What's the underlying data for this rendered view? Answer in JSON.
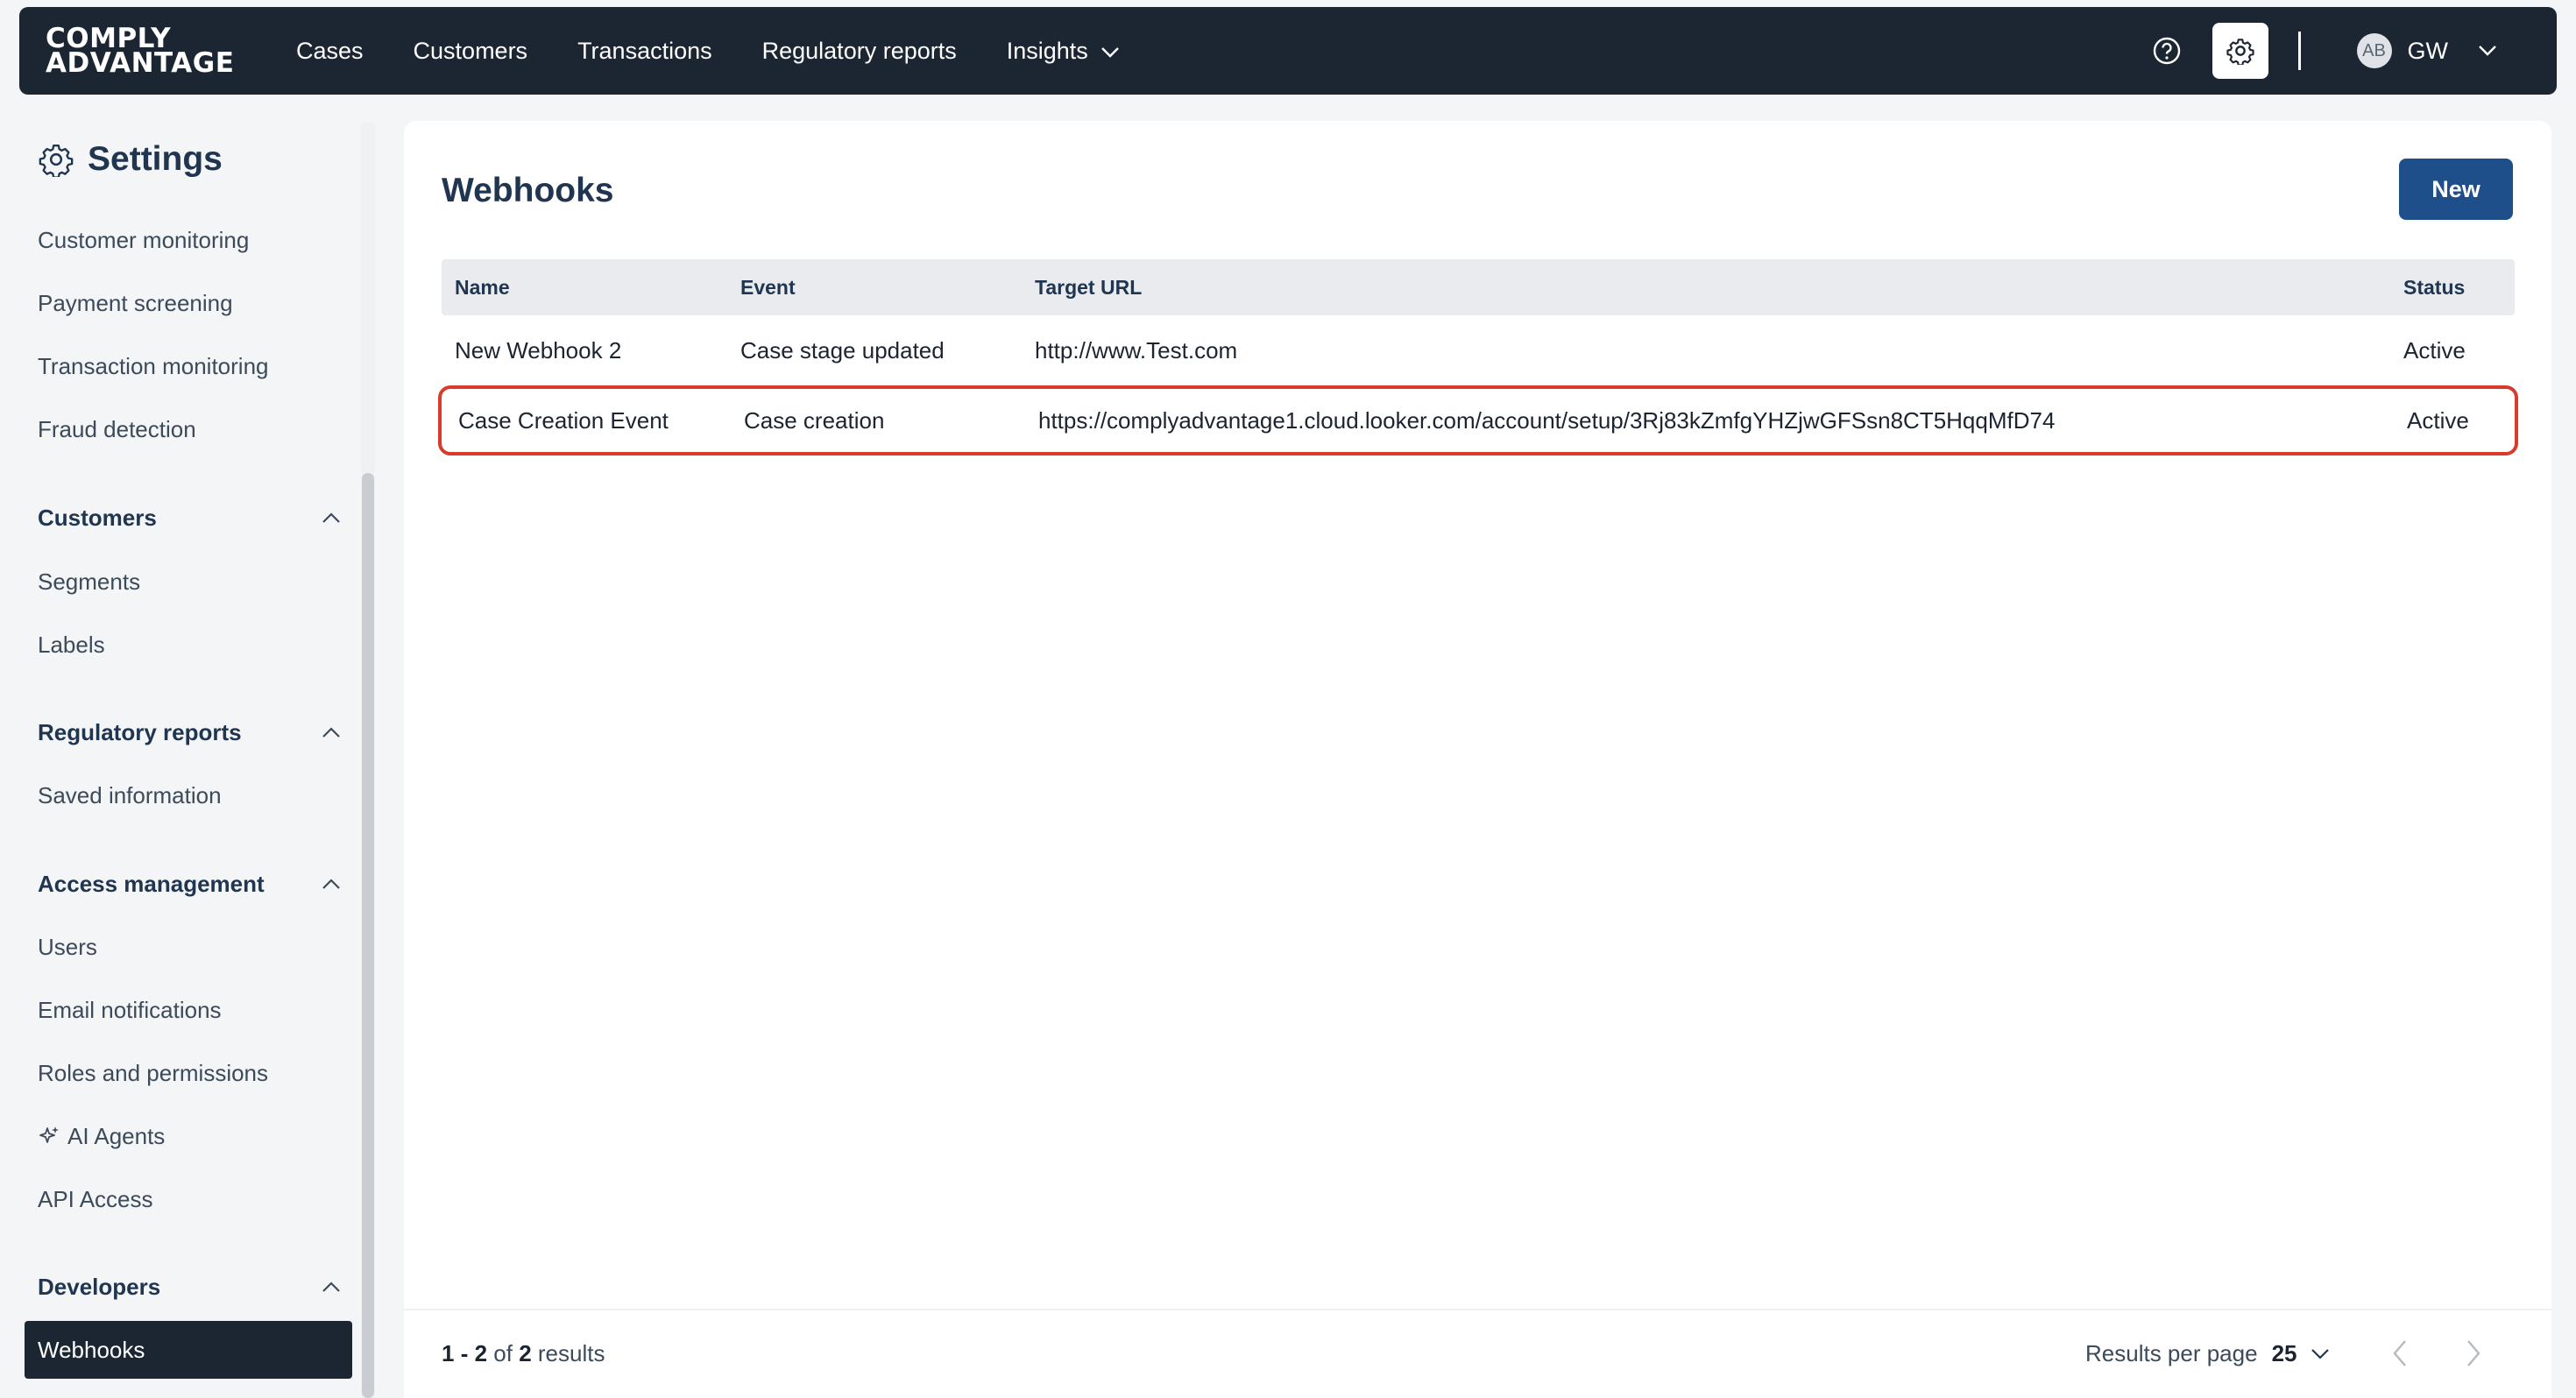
{
  "logo": {
    "line1": "COMPLY",
    "line2": "ADVANTAGE"
  },
  "nav": {
    "items": [
      {
        "label": "Cases"
      },
      {
        "label": "Customers"
      },
      {
        "label": "Transactions"
      },
      {
        "label": "Regulatory reports"
      },
      {
        "label": "Insights"
      }
    ]
  },
  "user": {
    "avatar_initials": "AB",
    "initials": "GW"
  },
  "sidebar": {
    "title": "Settings",
    "top_items": [
      {
        "label": "Customer monitoring"
      },
      {
        "label": "Payment screening"
      },
      {
        "label": "Transaction monitoring"
      },
      {
        "label": "Fraud detection"
      }
    ],
    "sections": {
      "customers": {
        "label": "Customers",
        "items": [
          "Segments",
          "Labels"
        ]
      },
      "regulatory": {
        "label": "Regulatory reports",
        "items": [
          "Saved information"
        ]
      },
      "access": {
        "label": "Access management",
        "items": [
          "Users",
          "Email notifications",
          "Roles and permissions",
          "AI Agents",
          "API Access"
        ]
      },
      "developers": {
        "label": "Developers",
        "items": [
          "Webhooks"
        ]
      }
    }
  },
  "main": {
    "title": "Webhooks",
    "new_button": "New",
    "table": {
      "headers": [
        "Name",
        "Event",
        "Target URL",
        "Status"
      ],
      "rows": [
        [
          "New Webhook 2",
          "Case stage updated",
          "http://www.Test.com",
          "Active"
        ],
        [
          "Case Creation Event",
          "Case creation",
          "https://complyadvantage1.cloud.looker.com/account/setup/3Rj83kZmfgYHZjwGFSsn8CT5HqqMfD74",
          "Active"
        ]
      ]
    },
    "pagination": {
      "range_start": "1",
      "range_sep": " - ",
      "range_end": "2",
      "of": " of ",
      "total": "2",
      "suffix": " results",
      "per_page_label": "Results per page",
      "per_page_value": "25"
    }
  },
  "colors": {
    "nav_bg": "#1c2632",
    "accent": "#1f4f8a",
    "highlight_border": "#d93a2b"
  }
}
